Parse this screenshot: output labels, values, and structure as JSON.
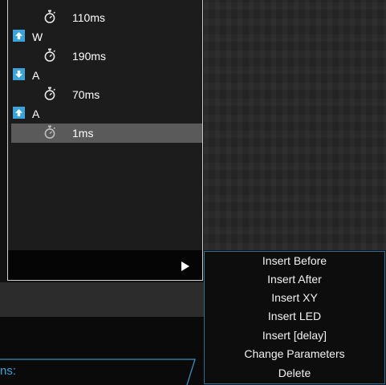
{
  "macro_list": {
    "rows": [
      {
        "kind": "delay",
        "text": "110ms"
      },
      {
        "kind": "key",
        "direction": "up",
        "text": "W"
      },
      {
        "kind": "delay",
        "text": "190ms"
      },
      {
        "kind": "key",
        "direction": "down",
        "text": "A"
      },
      {
        "kind": "delay",
        "text": "70ms"
      },
      {
        "kind": "key",
        "direction": "up",
        "text": "A"
      },
      {
        "kind": "delay",
        "text": "1ms",
        "selected": true
      }
    ]
  },
  "context_menu": {
    "items": [
      "Insert Before",
      "Insert After",
      "Insert XY",
      "Insert LED",
      "Insert [delay]",
      "Change Parameters",
      "Delete"
    ]
  },
  "bottom_label": "ns:",
  "colors": {
    "accent": "#3aa3d9",
    "selected_row": "#5a5a5a",
    "menu_border": "#2f6f93"
  },
  "icons": {
    "up": "arrow-up-icon",
    "down": "arrow-down-icon",
    "delay": "stopwatch-icon",
    "play": "play-icon"
  }
}
